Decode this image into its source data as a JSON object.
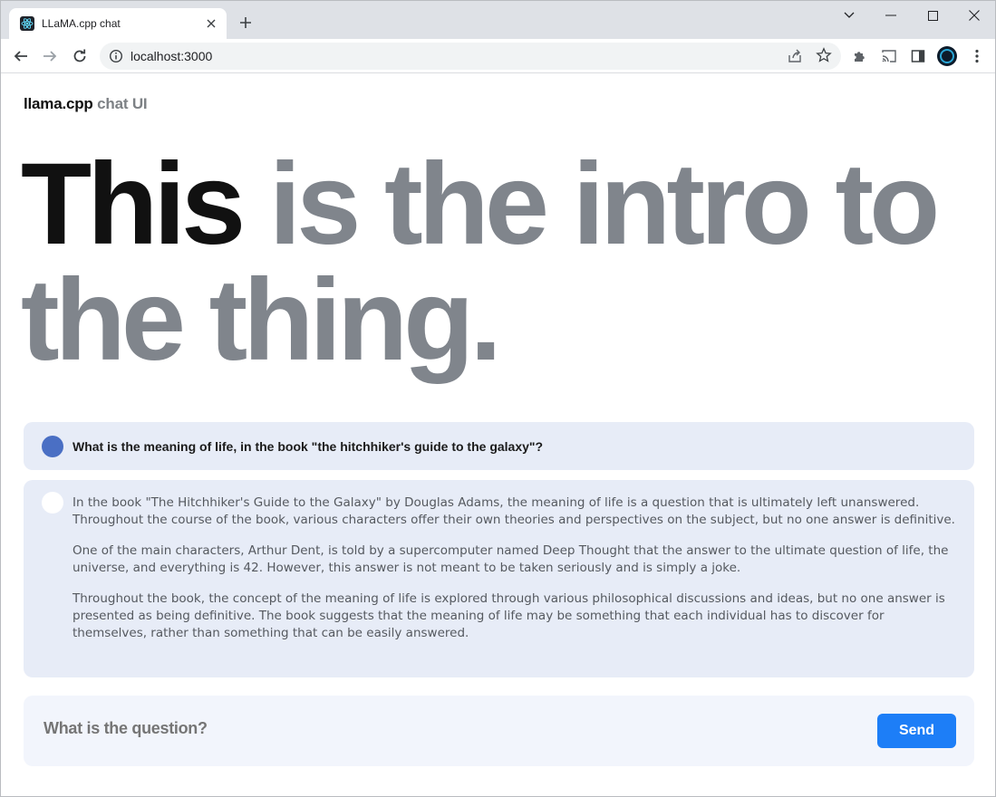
{
  "browser": {
    "tab_title": "LLaMA.cpp chat",
    "url": "localhost:3000",
    "icons": [
      "react-favicon-icon",
      "close-icon",
      "plus-icon",
      "chevron-down-icon",
      "minimize-icon",
      "maximize-icon",
      "window-close-icon",
      "back-icon",
      "forward-icon",
      "reload-icon",
      "info-icon",
      "share-icon",
      "star-icon",
      "extensions-icon",
      "cast-icon",
      "sidepanel-icon",
      "profile-avatar",
      "menu-icon"
    ]
  },
  "header": {
    "brand_primary": "llama.cpp",
    "brand_secondary": "chat UI"
  },
  "hero": {
    "emphasis": "This",
    "rest": "is the intro to the thing."
  },
  "conversation": {
    "question": "What is the meaning of life, in the book \"the hitchhiker's guide to the galaxy\"?",
    "answer_paragraphs": [
      "In the book \"The Hitchhiker's Guide to the Galaxy\" by Douglas Adams, the meaning of life is a question that is ultimately left unanswered. Throughout the course of the book, various characters offer their own theories and perspectives on the subject, but no one answer is definitive.",
      "One of the main characters, Arthur Dent, is told by a supercomputer named Deep Thought that the answer to the ultimate question of life, the universe, and everything is 42. However, this answer is not meant to be taken seriously and is simply a joke.",
      "Throughout the book, the concept of the meaning of life is explored through various philosophical discussions and ideas, but no one answer is presented as being definitive. The book suggests that the meaning of life may be something that each individual has to discover for themselves, rather than something that can be easily answered."
    ]
  },
  "composer": {
    "placeholder": "What is the question?",
    "send_label": "Send"
  },
  "colors": {
    "accent": "#1d7ef7",
    "message_bg": "#e7ecf7",
    "user_avatar": "#4a6fc4",
    "hero_muted": "#80858c"
  }
}
